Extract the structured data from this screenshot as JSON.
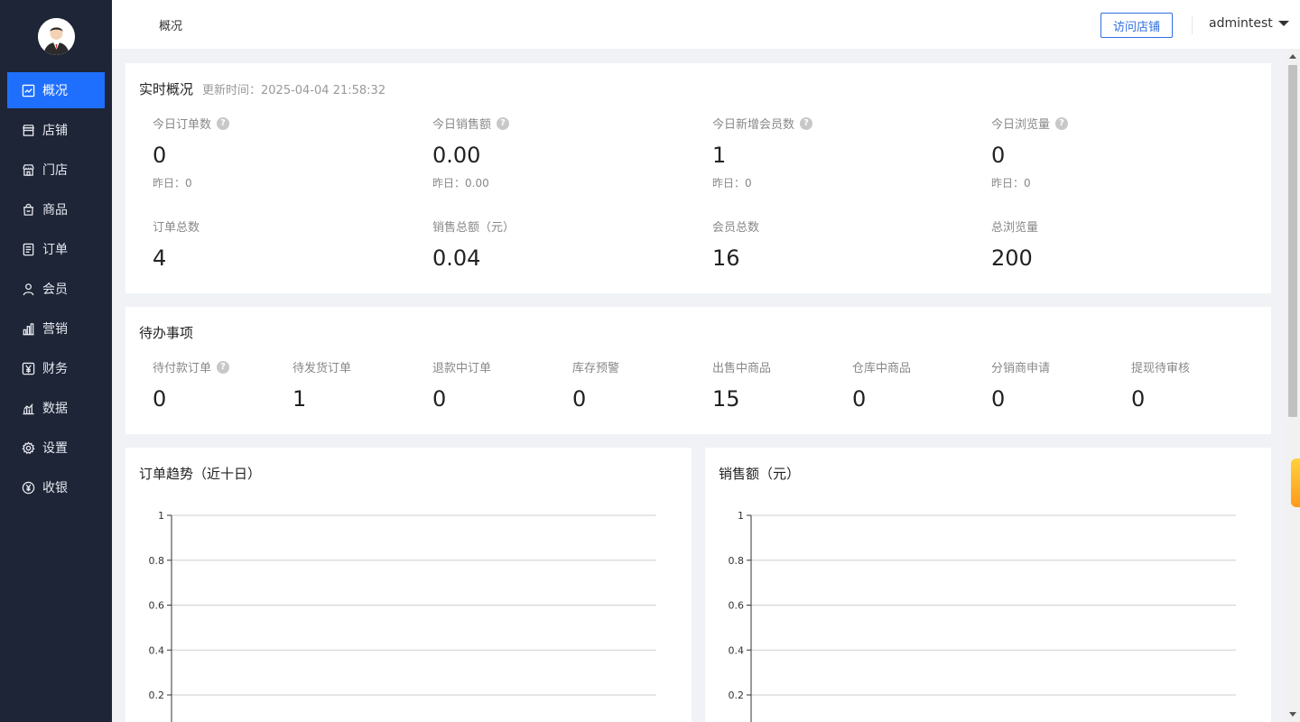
{
  "sidebar": {
    "items": [
      {
        "label": "概况",
        "icon": "trend-icon",
        "active": true
      },
      {
        "label": "店铺",
        "icon": "shop-icon",
        "active": false
      },
      {
        "label": "门店",
        "icon": "store-icon",
        "active": false
      },
      {
        "label": "商品",
        "icon": "bag-icon",
        "active": false
      },
      {
        "label": "订单",
        "icon": "order-icon",
        "active": false
      },
      {
        "label": "会员",
        "icon": "user-icon",
        "active": false
      },
      {
        "label": "营销",
        "icon": "bar-icon",
        "active": false
      },
      {
        "label": "财务",
        "icon": "yuan-icon",
        "active": false
      },
      {
        "label": "数据",
        "icon": "data-icon",
        "active": false
      },
      {
        "label": "设置",
        "icon": "gear-icon",
        "active": false
      },
      {
        "label": "收银",
        "icon": "cashier-icon",
        "active": false
      }
    ]
  },
  "header": {
    "breadcrumb": "概况",
    "visit_label": "访问店铺",
    "username": "admintest"
  },
  "realtime": {
    "title": "实时概况",
    "updated": "更新时间：2025-04-04 21:58:32",
    "today": [
      {
        "label": "今日订单数",
        "value": "0",
        "yesterday": "昨日：0"
      },
      {
        "label": "今日销售额",
        "value": "0.00",
        "yesterday": "昨日：0.00"
      },
      {
        "label": "今日新增会员数",
        "value": "1",
        "yesterday": "昨日：0"
      },
      {
        "label": "今日浏览量",
        "value": "0",
        "yesterday": "昨日：0"
      }
    ],
    "totals": [
      {
        "label": "订单总数",
        "value": "4"
      },
      {
        "label": "销售总额（元）",
        "value": "0.04"
      },
      {
        "label": "会员总数",
        "value": "16"
      },
      {
        "label": "总浏览量",
        "value": "200"
      }
    ]
  },
  "todo": {
    "title": "待办事项",
    "items": [
      {
        "label": "待付款订单",
        "value": "0"
      },
      {
        "label": "待发货订单",
        "value": "1"
      },
      {
        "label": "退款中订单",
        "value": "0"
      },
      {
        "label": "库存预警",
        "value": "0"
      },
      {
        "label": "出售中商品",
        "value": "15"
      },
      {
        "label": "仓库中商品",
        "value": "0"
      },
      {
        "label": "分销商申请",
        "value": "0"
      },
      {
        "label": "提现待审核",
        "value": "0"
      }
    ]
  },
  "chart_data": [
    {
      "type": "line",
      "title": "订单趋势（近十日）",
      "ylim": [
        0,
        1
      ],
      "y_ticks": [
        "1",
        "0.8",
        "0.6",
        "0.4",
        "0.2"
      ],
      "grid": true
    },
    {
      "type": "line",
      "title": "销售额（元）",
      "ylim": [
        0,
        1
      ],
      "y_ticks": [
        "1",
        "0.8",
        "0.6",
        "0.4",
        "0.2"
      ],
      "grid": true
    }
  ],
  "colors": {
    "sidebar_bg": "#1e2537",
    "accent": "#1f6fff",
    "visit_btn": "#2f6ee0"
  }
}
